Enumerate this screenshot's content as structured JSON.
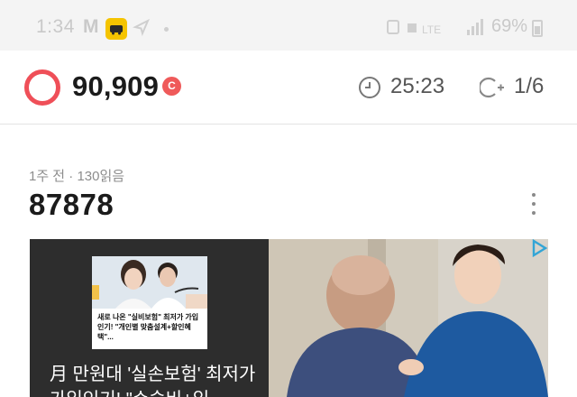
{
  "status_bar": {
    "time": "1:34",
    "carrier_letter": "M",
    "app_badge_icon": "kakao-bus-icon",
    "battery_percent": "69%"
  },
  "header": {
    "points": "90,909",
    "coin_label": "C",
    "timer": "25:23",
    "progress": "1/6",
    "accent_color": "#ef4f58"
  },
  "article": {
    "meta": "1주 전 · 130읽음",
    "title": "87878"
  },
  "ad": {
    "thumb_caption": "새로 나온 \"실비보험\" 최저가 가입인기! \"개인별 맞춤설계+할인혜택\"...",
    "headline": "月 만원대 '실손보험' 최저가 가입인기! \"수술비+입"
  }
}
